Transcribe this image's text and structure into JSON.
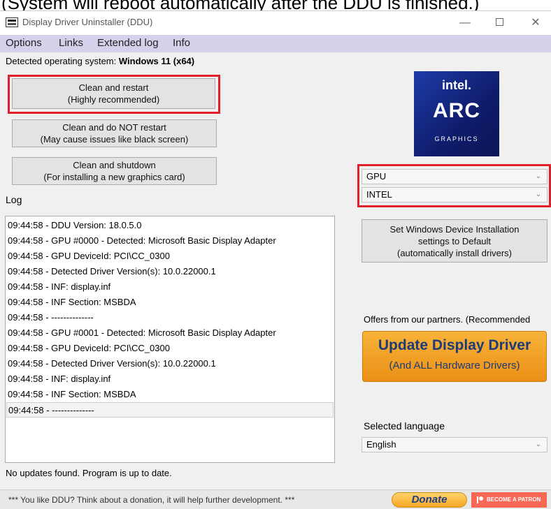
{
  "caption": "(System will reboot automatically after the DDU is finished.)",
  "window": {
    "title": "Display Driver Uninstaller (DDU)",
    "controls": {
      "minimize": "—",
      "close": "✕"
    }
  },
  "menu": [
    "Options",
    "Links",
    "Extended log",
    "Info"
  ],
  "os": {
    "label": "Detected operating system: ",
    "value": "Windows 11 (x64)"
  },
  "actions": {
    "clean_restart": {
      "line1": "Clean and restart",
      "line2": "(Highly recommended)"
    },
    "clean_no_restart": {
      "line1": "Clean and do NOT restart",
      "line2": "(May cause issues like black screen)"
    },
    "clean_shutdown": {
      "line1": "Clean and shutdown",
      "line2": "(For installing a new graphics card)"
    }
  },
  "logo": {
    "brand": "intel.",
    "product": "ARC",
    "sub": "GRAPHICS"
  },
  "device_type": "GPU",
  "vendor": "INTEL",
  "device_settings_button": [
    "Set Windows Device Installation",
    "settings to Default",
    "(automatically install drivers)"
  ],
  "log": {
    "label": "Log",
    "lines": [
      "09:44:58 - DDU Version: 18.0.5.0",
      "09:44:58 - GPU #0000 - Detected: Microsoft Basic Display Adapter",
      "09:44:58 - GPU DeviceId: PCI\\CC_0300",
      "09:44:58 - Detected Driver Version(s): 10.0.22000.1",
      "09:44:58 - INF: display.inf",
      "09:44:58 - INF Section: MSBDA",
      "09:44:58 - --------------",
      "09:44:58 - GPU #0001 - Detected: Microsoft Basic Display Adapter",
      "09:44:58 - GPU DeviceId: PCI\\CC_0300",
      "09:44:58 - Detected Driver Version(s): 10.0.22000.1",
      "09:44:58 - INF: display.inf",
      "09:44:58 - INF Section: MSBDA",
      "09:44:58 - --------------"
    ]
  },
  "partners": {
    "title": "Offers from our partners. (Recommended",
    "button_line1": "Update Display Driver",
    "button_line2": "(And ALL Hardware Drivers)"
  },
  "language": {
    "label": "Selected language",
    "value": "English"
  },
  "status": "No updates found. Program is up to date.",
  "footer": {
    "text": "*** You like DDU? Think about a donation, it will help further development. ***",
    "donate": "Donate",
    "patron": "BECOME A PATRON"
  },
  "colors": {
    "highlight": "#e2202c",
    "menubar": "#d4d2ea",
    "update_button": "#f0a126",
    "patreon": "#f96854"
  }
}
